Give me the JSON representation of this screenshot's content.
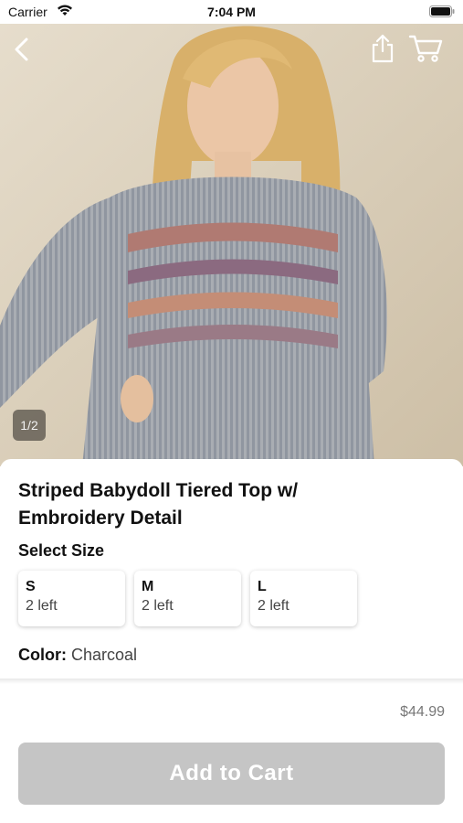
{
  "status_bar": {
    "carrier": "Carrier",
    "time": "7:04 PM"
  },
  "nav": {
    "back_icon": "chevron-left-icon",
    "share_icon": "share-icon",
    "cart_icon": "cart-icon"
  },
  "gallery": {
    "counter": "1/2"
  },
  "product": {
    "title": "Striped Babydoll Tiered Top w/ Embroidery Detail",
    "select_size_label": "Select Size",
    "sizes": [
      {
        "name": "S",
        "stock": "2 left"
      },
      {
        "name": "M",
        "stock": "2 left"
      },
      {
        "name": "L",
        "stock": "2 left"
      }
    ],
    "color_label": "Color:",
    "color_value": "Charcoal",
    "price": "$44.99",
    "add_to_cart_label": "Add to Cart"
  },
  "colors": {
    "button_disabled": "#c5c5c5",
    "accent_text": "#111111"
  }
}
